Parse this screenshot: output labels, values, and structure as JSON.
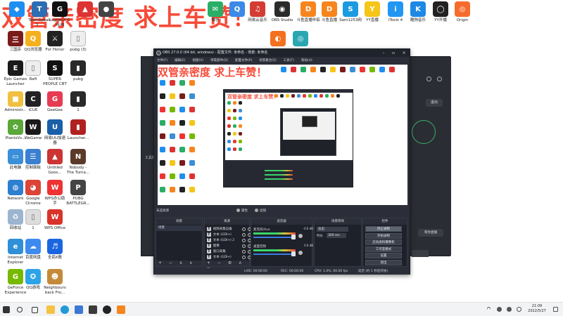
{
  "overlay": {
    "title": "双管亲密度 求上车赞！"
  },
  "colors": {
    "accent_red": "#f53c28",
    "obs_bg": "#2b2e38",
    "obs_dark": "#1e2129",
    "meter_green": "#3ad46a"
  },
  "desktop": {
    "top_row": [
      {
        "label": "",
        "color": "#1f8ef1",
        "glyph": "◆",
        "icon": "app-icon"
      },
      {
        "label": "TeamSpeak\n3 ...",
        "color": "#2c6db3",
        "glyph": "T",
        "icon": "teamspeak-icon"
      },
      {
        "label": "Logitech G\nHUB",
        "color": "#111111",
        "glyph": "G",
        "icon": "logitech-icon"
      },
      {
        "label": "",
        "color": "#d33",
        "glyph": "▲",
        "icon": "app-icon"
      },
      {
        "label": "",
        "color": "#444",
        "glyph": "●",
        "icon": "app-icon"
      },
      {
        "label": "微信",
        "color": "#2aae67",
        "glyph": "✉",
        "icon": "wechat-icon"
      },
      {
        "label": "",
        "color": "#3c89e8",
        "glyph": "Q",
        "icon": "qq-icon"
      },
      {
        "label": "网易云音乐",
        "color": "#d43c33",
        "glyph": "♫",
        "icon": "netease-music-icon"
      },
      {
        "label": "OBS Studio",
        "color": "#2a2a2a",
        "glyph": "◉",
        "icon": "obs-icon"
      },
      {
        "label": "斗鱼直播伴侣",
        "color": "#f7851d",
        "glyph": "D",
        "icon": "douyu-icon"
      },
      {
        "label": "斗鱼直播",
        "color": "#f7851d",
        "glyph": "D",
        "icon": "douyu-icon"
      },
      {
        "label": "Sam1253网",
        "color": "#1b9be0",
        "glyph": "S",
        "icon": "app-icon"
      },
      {
        "label": "YY直播",
        "color": "#f5c518",
        "glyph": "Y",
        "icon": "yy-icon"
      },
      {
        "label": "iTools 4",
        "color": "#2196f3",
        "glyph": "i",
        "icon": "itools-icon"
      },
      {
        "label": "酷狗音乐",
        "color": "#1e88e5",
        "glyph": "K",
        "icon": "kugou-icon"
      },
      {
        "label": "YY开播",
        "color": "#222222",
        "glyph": "◯",
        "icon": "yy-icon"
      },
      {
        "label": "Origin",
        "color": "#f56c2d",
        "glyph": "◎",
        "icon": "origin-icon"
      }
    ],
    "col_a": [
      {
        "label": "三国杀",
        "color": "#7a1b1b",
        "glyph": "三",
        "icon": "app-icon"
      },
      {
        "label": "Epic Games\nLauncher",
        "color": "#1a1a1a",
        "glyph": "E",
        "icon": "epic-icon"
      },
      {
        "label": "Administr...",
        "color": "#f0c040",
        "glyph": "■",
        "icon": "folder-icon"
      },
      {
        "label": "PlantsVs...",
        "color": "#5aa83a",
        "glyph": "✿",
        "icon": "app-icon"
      },
      {
        "label": "此电脑",
        "color": "#3a8fd8",
        "glyph": "▭",
        "icon": "computer-icon"
      },
      {
        "label": "Network",
        "color": "#2d7fd0",
        "glyph": "◍",
        "icon": "network-icon"
      },
      {
        "label": "回收站",
        "color": "#9cb4d0",
        "glyph": "♻",
        "icon": "recycle-bin-icon"
      },
      {
        "label": "Internet\nExplorer",
        "color": "#2f8fd8",
        "glyph": "e",
        "icon": "ie-icon"
      },
      {
        "label": "GeForce\nExperience",
        "color": "#76b900",
        "glyph": "G",
        "icon": "geforce-icon"
      }
    ],
    "col_b": [
      {
        "label": "QQ浏览器",
        "color": "#f5b01e",
        "glyph": "Q",
        "icon": "qq-browser-icon"
      },
      {
        "label": "Raft",
        "color": "#eeeeee",
        "glyph": "▯",
        "icon": "file-icon"
      },
      {
        "label": "iCUE",
        "color": "#222222",
        "glyph": "C",
        "icon": "icue-icon"
      },
      {
        "label": "WeGame",
        "color": "#1a1a1a",
        "glyph": "W",
        "icon": "wegame-icon"
      },
      {
        "label": "控制面板",
        "color": "#3a7fd0",
        "glyph": "☰",
        "icon": "control-panel-icon"
      },
      {
        "label": "Google\nChrome",
        "color": "#db4437",
        "glyph": "◕",
        "icon": "chrome-icon"
      },
      {
        "label": "1",
        "color": "#dddddd",
        "glyph": "▯",
        "icon": "file-icon"
      },
      {
        "label": "百度网盘",
        "color": "#3d8bef",
        "glyph": "☁",
        "icon": "baidu-pan-icon"
      },
      {
        "label": "QQ游戏",
        "color": "#2ea4e8",
        "glyph": "✪",
        "icon": "qq-game-icon"
      }
    ],
    "col_c": [
      {
        "label": "For Honor",
        "color": "#222222",
        "glyph": "⚔",
        "icon": "app-icon"
      },
      {
        "label": "SUPER\nPEOPLE CBT",
        "color": "#111111",
        "glyph": "S",
        "icon": "app-icon"
      },
      {
        "label": "GeeGee",
        "color": "#e63b53",
        "glyph": "G",
        "icon": "app-icon"
      },
      {
        "label": "网易UU加速\n器",
        "color": "#1a5fa8",
        "glyph": "U",
        "icon": "uu-icon"
      },
      {
        "label": "Untitled\nGoos...",
        "color": "#c33",
        "glyph": "▲",
        "icon": "app-icon"
      },
      {
        "label": "WPS办公助\n手",
        "color": "#e33",
        "glyph": "W",
        "icon": "wps-icon"
      },
      {
        "label": "WPS Office",
        "color": "#d9342b",
        "glyph": "W",
        "icon": "wps-icon"
      },
      {
        "label": "全民K歌",
        "color": "#1a66e0",
        "glyph": "♬",
        "icon": "app-icon"
      },
      {
        "label": "Neighbours\nback Fro...",
        "color": "#c48a3a",
        "glyph": "☻",
        "icon": "app-icon"
      }
    ],
    "col_d": [
      {
        "label": "pubg (3)",
        "color": "#eeeeee",
        "glyph": "▯",
        "icon": "file-icon"
      },
      {
        "label": "pubg",
        "color": "#2a2a2a",
        "glyph": "▮",
        "icon": "file-icon"
      },
      {
        "label": "1",
        "color": "#2a2a2a",
        "glyph": "▮",
        "icon": "file-icon"
      },
      {
        "label": "Launcher...",
        "color": "#b02020",
        "glyph": "▮",
        "icon": "app-icon"
      },
      {
        "label": "Nobody -\nThe Turna...",
        "color": "#5b3a2a",
        "glyph": "N",
        "icon": "app-icon"
      },
      {
        "label": "PUBG\nBATTLEGR...",
        "color": "#444444",
        "glyph": "P",
        "icon": "pubg-icon"
      }
    ],
    "row2_extra": [
      {
        "label": "",
        "color": "#f2701e",
        "glyph": "◐",
        "icon": "app-icon"
      },
      {
        "label": "",
        "color": "#2aa6b3",
        "glyph": "◎",
        "icon": "app-icon"
      }
    ]
  },
  "bg_app": {
    "tools_label": "工具箱",
    "exit_label": "退出",
    "settings_label": "帮你直播"
  },
  "obs": {
    "title": "OBS 27.0.0 (64-bit, windows) - 配置文件: 未命名 - 场景: 未命名",
    "menu": [
      "文件(F)",
      "编辑(E)",
      "视图(V)",
      "停靠部件(D)",
      "配置文件(P)",
      "场景集合(S)",
      "工具(T)",
      "帮助(H)"
    ],
    "no_source": "未选择源",
    "properties": "属性",
    "filters": "滤镜",
    "docks": {
      "scenes": {
        "title": "场景",
        "items": [
          "场景"
        ]
      },
      "sources": {
        "title": "来源",
        "items": [
          "视频采集设备",
          "文本 (GDI+)",
          "文本 (GDI+) 2",
          "图像",
          "窗口采集",
          "文本 (GDI+)"
        ]
      },
      "mixer": {
        "title": "混音器",
        "items": [
          {
            "name": "麦克风/Aux",
            "level": "-0.0 dB"
          },
          {
            "name": "桌面音频",
            "level": "0.0 dB"
          }
        ]
      },
      "transitions": {
        "title": "场景转场",
        "selected": "淡出",
        "duration_label": "时长",
        "duration": "300 ms"
      },
      "controls": {
        "title": "控件",
        "buttons": [
          "停止录制",
          "开始录制",
          "启动虚拟摄像机",
          "工作室模式",
          "设置",
          "退出"
        ]
      }
    },
    "status": {
      "live": "LIVE: 00:00:00",
      "rec": "REC: 00:00:00",
      "cpu": "CPU: 1.0%, 60.00 fps",
      "delay": "延迟 (约 1 秒后开始)"
    }
  },
  "taskbar": {
    "time": "21:09",
    "date": "2022/5/27"
  }
}
